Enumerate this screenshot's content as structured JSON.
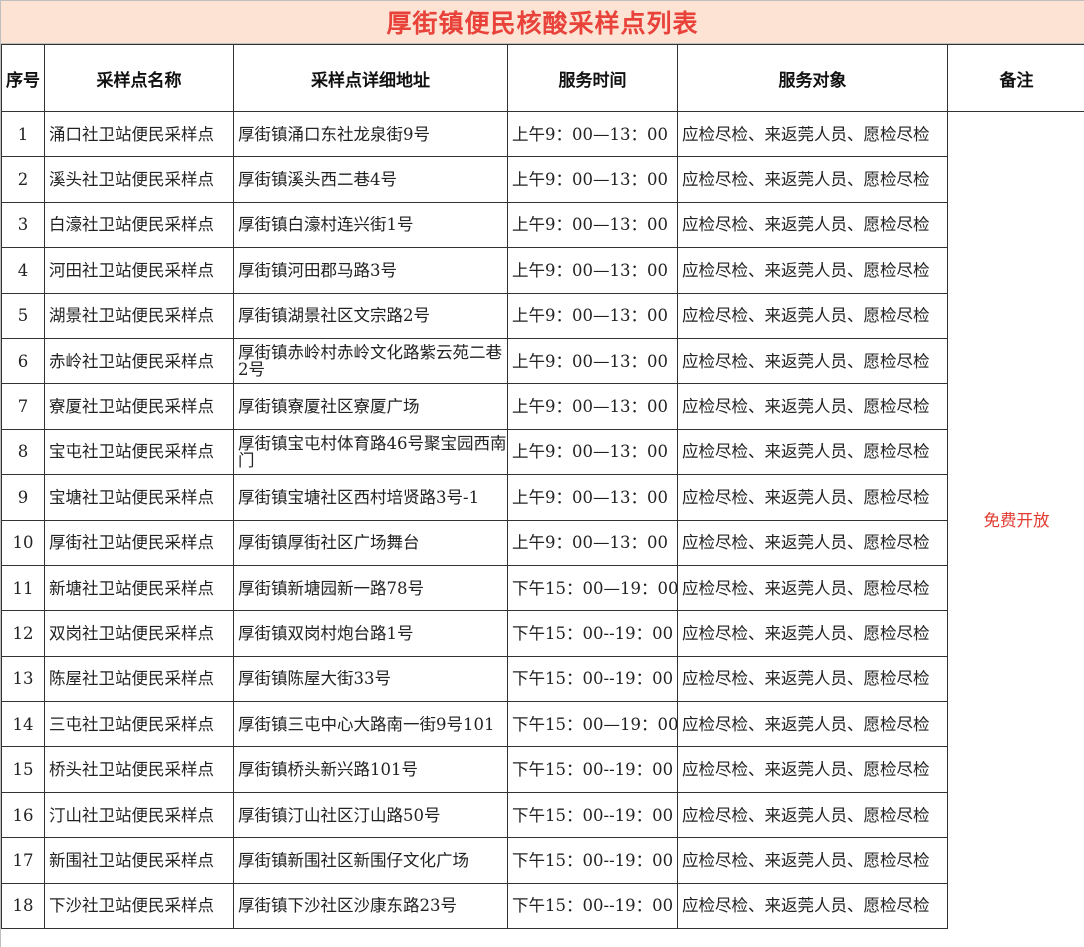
{
  "title": "厚街镇便民核酸采样点列表",
  "columns": [
    "序号",
    "采样点名称",
    "采样点详细地址",
    "服务时间",
    "服务对象",
    "备注"
  ],
  "remark": "免费开放",
  "colors": {
    "title_bg": "#fde3d3",
    "title_text": "#e8423a",
    "remark_text": "#e23b2f",
    "border": "#333333"
  },
  "rows": [
    {
      "no": "1",
      "name": "涌口社卫站便民采样点",
      "address": "厚街镇涌口东社龙泉街9号",
      "time": "上午9：00—13：00",
      "target": "应检尽检、来返莞人员、愿检尽检"
    },
    {
      "no": "2",
      "name": "溪头社卫站便民采样点",
      "address": "厚街镇溪头西二巷4号",
      "time": "上午9：00—13：00",
      "target": "应检尽检、来返莞人员、愿检尽检"
    },
    {
      "no": "3",
      "name": "白濠社卫站便民采样点",
      "address": "厚街镇白濠村连兴街1号",
      "time": "上午9：00—13：00",
      "target": "应检尽检、来返莞人员、愿检尽检"
    },
    {
      "no": "4",
      "name": "河田社卫站便民采样点",
      "address": "厚街镇河田郡马路3号",
      "time": "上午9：00—13：00",
      "target": "应检尽检、来返莞人员、愿检尽检"
    },
    {
      "no": "5",
      "name": "湖景社卫站便民采样点",
      "address": "厚街镇湖景社区文宗路2号",
      "time": "上午9：00—13：00",
      "target": "应检尽检、来返莞人员、愿检尽检"
    },
    {
      "no": "6",
      "name": "赤岭社卫站便民采样点",
      "address": "厚街镇赤岭村赤岭文化路紫云苑二巷2号",
      "time": "上午9：00—13：00",
      "target": "应检尽检、来返莞人员、愿检尽检"
    },
    {
      "no": "7",
      "name": "寮厦社卫站便民采样点",
      "address": "厚街镇寮厦社区寮厦广场",
      "time": "上午9：00—13：00",
      "target": "应检尽检、来返莞人员、愿检尽检"
    },
    {
      "no": "8",
      "name": "宝屯社卫站便民采样点",
      "address": "厚街镇宝屯村体育路46号聚宝园西南门",
      "time": "上午9：00—13：00",
      "target": "应检尽检、来返莞人员、愿检尽检"
    },
    {
      "no": "9",
      "name": "宝塘社卫站便民采样点",
      "address": "厚街镇宝塘社区西村培贤路3号-1",
      "time": "上午9：00—13：00",
      "target": "应检尽检、来返莞人员、愿检尽检"
    },
    {
      "no": "10",
      "name": "厚街社卫站便民采样点",
      "address": "厚街镇厚街社区广场舞台",
      "time": "上午9：00—13：00",
      "target": "应检尽检、来返莞人员、愿检尽检"
    },
    {
      "no": "11",
      "name": "新塘社卫站便民采样点",
      "address": "厚街镇新塘园新一路78号",
      "time": "下午15：00—19：00",
      "target": "应检尽检、来返莞人员、愿检尽检"
    },
    {
      "no": "12",
      "name": "双岗社卫站便民采样点",
      "address": "厚街镇双岗村炮台路1号",
      "time": "下午15：00--19：00",
      "target": "应检尽检、来返莞人员、愿检尽检"
    },
    {
      "no": "13",
      "name": "陈屋社卫站便民采样点",
      "address": "厚街镇陈屋大街33号",
      "time": "下午15：00--19：00",
      "target": "应检尽检、来返莞人员、愿检尽检"
    },
    {
      "no": "14",
      "name": "三屯社卫站便民采样点",
      "address": "厚街镇三屯中心大路南一街9号101",
      "time": "下午15：00—19：00",
      "target": "应检尽检、来返莞人员、愿检尽检"
    },
    {
      "no": "15",
      "name": "桥头社卫站便民采样点",
      "address": "厚街镇桥头新兴路101号",
      "time": "下午15：00--19：00",
      "target": "应检尽检、来返莞人员、愿检尽检"
    },
    {
      "no": "16",
      "name": "汀山社卫站便民采样点",
      "address": "厚街镇汀山社区汀山路50号",
      "time": "下午15：00--19：00",
      "target": "应检尽检、来返莞人员、愿检尽检"
    },
    {
      "no": "17",
      "name": "新围社卫站便民采样点",
      "address": "厚街镇新围社区新围仔文化广场",
      "time": "下午15：00--19：00",
      "target": "应检尽检、来返莞人员、愿检尽检"
    },
    {
      "no": "18",
      "name": "下沙社卫站便民采样点",
      "address": "厚街镇下沙社区沙康东路23号",
      "time": "下午15：00--19：00",
      "target": "应检尽检、来返莞人员、愿检尽检"
    }
  ]
}
